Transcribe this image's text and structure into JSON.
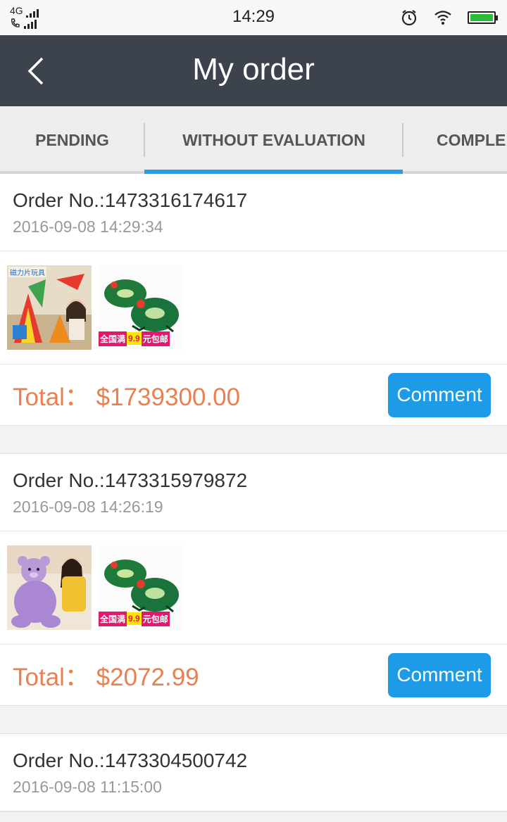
{
  "status_bar": {
    "network": "4G",
    "time": "14:29",
    "icons": [
      "alarm-icon",
      "wifi-icon",
      "battery-icon",
      "phone-icon",
      "signal-icon"
    ]
  },
  "header": {
    "title": "My order",
    "back_icon": "chevron-left-icon"
  },
  "tabs": [
    {
      "label": "PENDING",
      "active": false
    },
    {
      "label": "WITHOUT EVALUATION",
      "active": true
    },
    {
      "label": "COMPLE",
      "active": false
    }
  ],
  "orders": [
    {
      "order_no": "Order No.:1473316174617",
      "date": "2016-09-08 14:29:34",
      "products": [
        "magnetic-toy-thumbnail",
        "frog-toy-thumbnail"
      ],
      "total": "Total： $1739300.00",
      "action": "Comment"
    },
    {
      "order_no": "Order No.:1473315979872",
      "date": "2016-09-08 14:26:19",
      "products": [
        "purple-bear-thumbnail",
        "frog-toy-thumbnail"
      ],
      "total": "Total： $2072.99",
      "action": "Comment"
    },
    {
      "order_no": "Order No.:1473304500742",
      "date": "2016-09-08 11:15:00"
    }
  ],
  "product_text": {
    "toy_header": "磁力片玩具",
    "promo_a": "全国满",
    "promo_b": "9.9",
    "promo_c": "元包邮"
  },
  "colors": {
    "navbar": "#3d434c",
    "accent": "#1e9be6",
    "total": "#e8804f"
  }
}
